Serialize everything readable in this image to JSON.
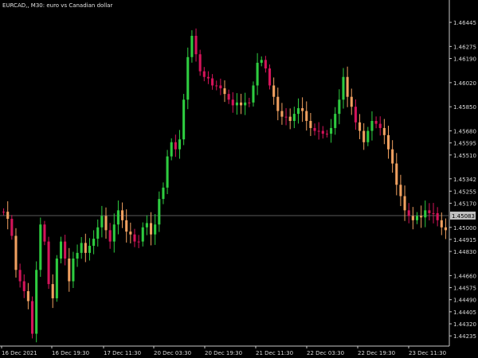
{
  "chart_data": {
    "type": "line",
    "title": "EURCAD,, M30:  euro vs Canadian dollar",
    "ylim": [
      1.4418,
      1.4658
    ],
    "y_ticks": [
      "1.46445",
      "1.46275",
      "1.46190",
      "1.46020",
      "1.45850",
      "1.45680",
      "1.45595",
      "1.45510",
      "1.45342",
      "1.45255",
      "1.45170",
      "1.45000",
      "1.44915",
      "1.44830",
      "1.44660",
      "1.44575",
      "1.44490",
      "1.44405",
      "1.44320",
      "1.44235"
    ],
    "x_ticks": [
      "16 Dec 2021",
      "16 Dec 19:30",
      "17 Dec 11:30",
      "20 Dec 03:30",
      "20 Dec 19:30",
      "21 Dec 11:30",
      "22 Dec 03:30",
      "22 Dec 19:30",
      "23 Dec 11:30"
    ],
    "current_price_label": "1.45083",
    "current_price": 1.45083,
    "colors": {
      "background": "#000000",
      "axis": "#c8c8c8",
      "text": "#d8d8d8",
      "price_line": "#5a5a5a",
      "up": "#2ecc40",
      "down": "#d4145a",
      "neutral": "#f0a060",
      "label_bg": "#c0c0c0"
    },
    "grid": false,
    "series": [
      {
        "values": [
          [
            0,
            1.4511
          ],
          [
            1,
            1.4506
          ],
          [
            2,
            1.4494
          ],
          [
            3,
            1.447
          ],
          [
            4,
            1.4462
          ],
          [
            5,
            1.4455
          ],
          [
            6,
            1.4448
          ],
          [
            7,
            1.4425
          ],
          [
            8,
            1.447
          ],
          [
            9,
            1.4502
          ],
          [
            10,
            1.449
          ],
          [
            11,
            1.446
          ],
          [
            12,
            1.445
          ],
          [
            13,
            1.4478
          ],
          [
            14,
            1.449
          ],
          [
            15,
            1.4478
          ],
          [
            16,
            1.4462
          ],
          [
            17,
            1.4478
          ],
          [
            18,
            1.4482
          ],
          [
            19,
            1.4489
          ],
          [
            20,
            1.4482
          ],
          [
            21,
            1.4487
          ],
          [
            22,
            1.4492
          ],
          [
            23,
            1.45
          ],
          [
            24,
            1.4508
          ],
          [
            25,
            1.4498
          ],
          [
            26,
            1.449
          ],
          [
            27,
            1.4502
          ],
          [
            28,
            1.4512
          ],
          [
            29,
            1.4505
          ],
          [
            30,
            1.4497
          ],
          [
            31,
            1.4495
          ],
          [
            32,
            1.449
          ],
          [
            33,
            1.449
          ],
          [
            34,
            1.45
          ],
          [
            35,
            1.4503
          ],
          [
            36,
            1.4495
          ],
          [
            37,
            1.4502
          ],
          [
            38,
            1.452
          ],
          [
            39,
            1.4528
          ],
          [
            40,
            1.455
          ],
          [
            41,
            1.456
          ],
          [
            42,
            1.4555
          ],
          [
            43,
            1.4562
          ],
          [
            44,
            1.459
          ],
          [
            45,
            1.462
          ],
          [
            46,
            1.4635
          ],
          [
            47,
            1.4622
          ],
          [
            48,
            1.461
          ],
          [
            49,
            1.4606
          ],
          [
            50,
            1.4605
          ],
          [
            51,
            1.46
          ],
          [
            52,
            1.46
          ],
          [
            53,
            1.4598
          ],
          [
            54,
            1.4594
          ],
          [
            55,
            1.459
          ],
          [
            56,
            1.4586
          ],
          [
            57,
            1.4588
          ],
          [
            58,
            1.4586
          ],
          [
            59,
            1.4588
          ],
          [
            60,
            1.4588
          ],
          [
            61,
            1.46
          ],
          [
            62,
            1.4616
          ],
          [
            63,
            1.4618
          ],
          [
            64,
            1.4612
          ],
          [
            65,
            1.46
          ],
          [
            66,
            1.4592
          ],
          [
            67,
            1.4582
          ],
          [
            68,
            1.4578
          ],
          [
            69,
            1.4578
          ],
          [
            70,
            1.4575
          ],
          [
            71,
            1.458
          ],
          [
            72,
            1.4584
          ],
          [
            73,
            1.4582
          ],
          [
            74,
            1.4575
          ],
          [
            75,
            1.457
          ],
          [
            76,
            1.4568
          ],
          [
            77,
            1.4568
          ],
          [
            78,
            1.4566
          ],
          [
            79,
            1.4566
          ],
          [
            80,
            1.457
          ],
          [
            81,
            1.458
          ],
          [
            82,
            1.459
          ],
          [
            83,
            1.4606
          ],
          [
            84,
            1.4592
          ],
          [
            85,
            1.4585
          ],
          [
            86,
            1.4574
          ],
          [
            87,
            1.4568
          ],
          [
            88,
            1.456
          ],
          [
            89,
            1.4568
          ],
          [
            90,
            1.4575
          ],
          [
            91,
            1.4573
          ],
          [
            92,
            1.457
          ],
          [
            93,
            1.4565
          ],
          [
            94,
            1.4555
          ],
          [
            95,
            1.4545
          ],
          [
            96,
            1.453
          ],
          [
            97,
            1.4522
          ],
          [
            98,
            1.4512
          ],
          [
            99,
            1.4508
          ],
          [
            100,
            1.4505
          ],
          [
            101,
            1.4508
          ],
          [
            102,
            1.4507
          ],
          [
            103,
            1.4512
          ],
          [
            104,
            1.451
          ],
          [
            105,
            1.451
          ],
          [
            106,
            1.4505
          ],
          [
            107,
            1.45
          ],
          [
            108,
            1.4498
          ]
        ]
      }
    ]
  }
}
